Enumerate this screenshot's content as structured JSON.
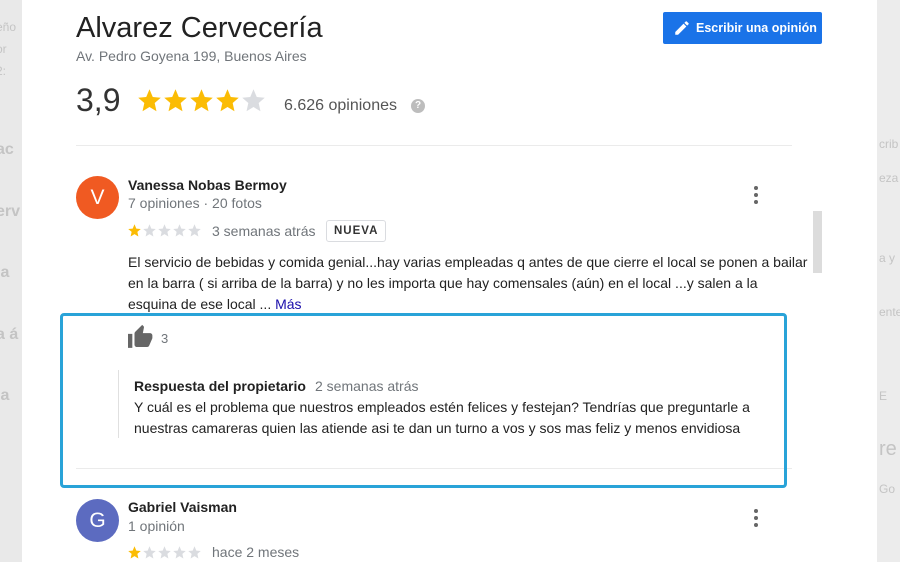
{
  "background": {
    "left_fragments": [
      "eño",
      "or",
      "2:",
      "ac",
      "erv",
      "ia",
      "a á",
      "ia"
    ],
    "right_fragments": [
      "crib",
      "eza",
      "a y",
      "ente",
      "E",
      "re",
      "Go"
    ]
  },
  "place": {
    "name": "Alvarez Cervecería",
    "address": "Av. Pedro Goyena 199, Buenos Aires",
    "rating": "3,9",
    "stars_filled": 4,
    "review_count": "6.626 opiniones",
    "help_icon": "?"
  },
  "toolbar": {
    "write_review_label": "Escribir una opinión",
    "write_icon": "pencil-icon"
  },
  "reviews": [
    {
      "avatar_letter": "V",
      "avatar_color": "#f05a22",
      "name": "Vanessa Nobas Bermoy",
      "meta": "7 opiniones · 20 fotos",
      "stars": 1,
      "date": "3 semanas atrás",
      "badge": "NUEVA",
      "text": "El servicio de bebidas y comida genial...hay varias empleadas q antes de que  cierre el local se ponen a bailar en la barra ( si arriba de la barra) y no les importa que hay comensales (aún) en el local ...y salen a la esquina de ese local ... ",
      "more_label": "Más",
      "likes": "3",
      "owner_reply": {
        "title": "Respuesta del propietario",
        "date": "2 semanas atrás",
        "text": "Y cuál es el problema que nuestros empleados estén felices y festejan? Tendrías que preguntarle a nuestras camareras quien las atiende asi te dan un turno a vos y sos mas feliz y menos envidiosa"
      }
    },
    {
      "avatar_letter": "G",
      "avatar_color": "#5c6bc0",
      "name": "Gabriel Vaisman",
      "meta": "1 opinión",
      "stars": 1,
      "date": "hace 2 meses"
    }
  ],
  "colors": {
    "accent": "#1a73e8",
    "star_gold": "#fbbc04",
    "star_gray": "#dadce0",
    "highlight": "#29a3d8"
  }
}
